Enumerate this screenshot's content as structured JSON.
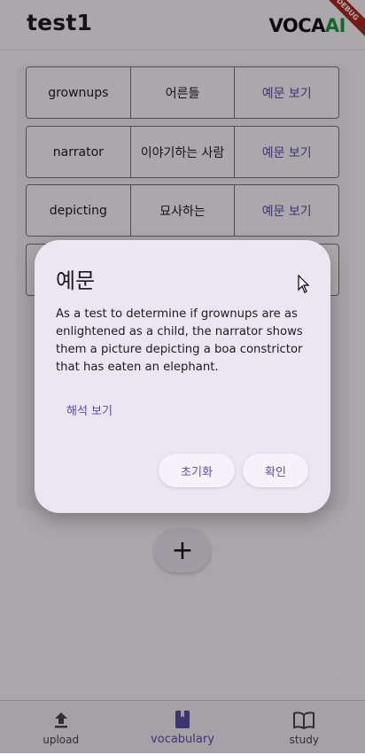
{
  "appbar": {
    "title": "test1",
    "logo_main": "VOCA",
    "logo_accent": "AI",
    "debug_badge": "DEBUG"
  },
  "vocab": [
    {
      "word": "grownups",
      "meaning": "어른들",
      "action": "예문 보기"
    },
    {
      "word": "narrator",
      "meaning": "이야기하는 사람",
      "action": "예문 보기"
    },
    {
      "word": "depicting",
      "meaning": "묘사하는",
      "action": "예문 보기"
    }
  ],
  "fab": {
    "label": "+"
  },
  "dialog": {
    "title": "예문",
    "body": "As a test to determine if grownups are as enlightened as a child, the narrator shows them a picture depicting a boa constrictor that has eaten an elephant.",
    "translate_label": "해석 보기",
    "reset_label": "초기화",
    "confirm_label": "확인"
  },
  "nav": [
    {
      "label": "upload",
      "icon": "upload-icon",
      "active": false
    },
    {
      "label": "vocabulary",
      "icon": "book-icon",
      "active": true
    },
    {
      "label": "study",
      "icon": "open-book-icon",
      "active": false
    }
  ],
  "colors": {
    "accent": "#5b4ea8",
    "logo_accent": "#1e9a3c",
    "debug": "#b3261e"
  }
}
